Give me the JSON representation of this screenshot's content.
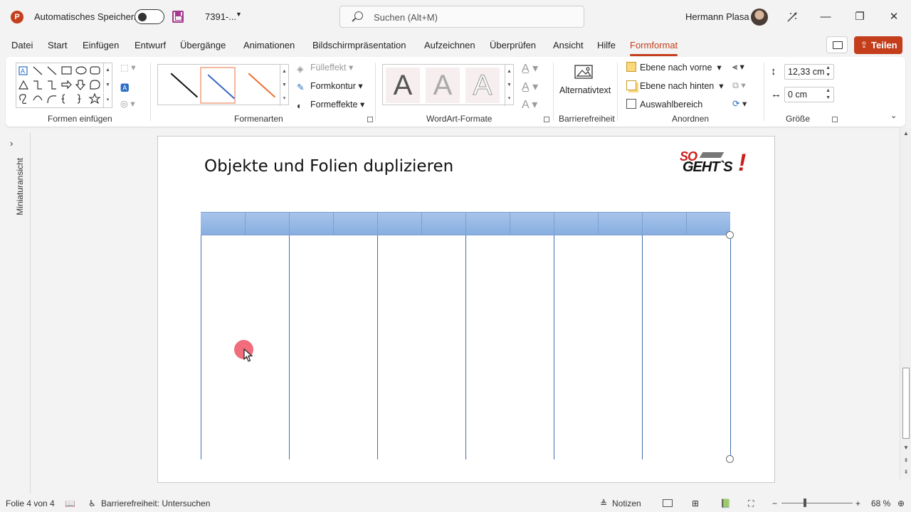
{
  "titlebar": {
    "app_icon": "P",
    "autosave_label": "Automatisches Speichern",
    "filename": "7391-...",
    "search_placeholder": "Suchen (Alt+M)",
    "user_name": "Hermann Plasa",
    "minimize": "—",
    "restore": "❐",
    "close": "✕"
  },
  "menu": {
    "tabs": [
      "Datei",
      "Start",
      "Einfügen",
      "Entwurf",
      "Übergänge",
      "Animationen",
      "Bildschirmpräsentation",
      "Aufzeichnen",
      "Überprüfen",
      "Ansicht",
      "Hilfe",
      "Formformat"
    ],
    "active_tab": "Formformat",
    "share_label": "Teilen"
  },
  "ribbon": {
    "groups": {
      "insert_shapes": "Formen einfügen",
      "shape_styles": "Formenarten",
      "wordart": "WordArt-Formate",
      "accessibility": "Barrierefreiheit",
      "arrange": "Anordnen",
      "size": "Größe"
    },
    "fill_effect": "Fülleffekt",
    "outline": "Formkontur",
    "effects": "Formeffekte",
    "wordart_letter": "A",
    "alt_text": "Alternativtext",
    "bring_forward": "Ebene nach vorne",
    "send_backward": "Ebene nach hinten",
    "selection_pane": "Auswahlbereich",
    "height_value": "12,33 cm",
    "width_value": "0 cm"
  },
  "thumbnail_pane": {
    "label": "Miniaturansicht",
    "chevron": "›"
  },
  "slide": {
    "title": "Objekte und Folien duplizieren",
    "logo_so": "SO",
    "logo_gehts": "GEHT`S",
    "logo_excl": "!",
    "header_columns": 12,
    "vertical_lines": 7
  },
  "status": {
    "slide_info": "Folie 4 von 4",
    "accessibility": "Barrierefreiheit: Untersuchen",
    "notes": "Notizen",
    "zoom": "68 %",
    "zoom_minus": "−",
    "zoom_plus": "+"
  },
  "colors": {
    "accent": "#c43e1c",
    "table_header": "#94b7e6",
    "line": "#3f6fad"
  }
}
